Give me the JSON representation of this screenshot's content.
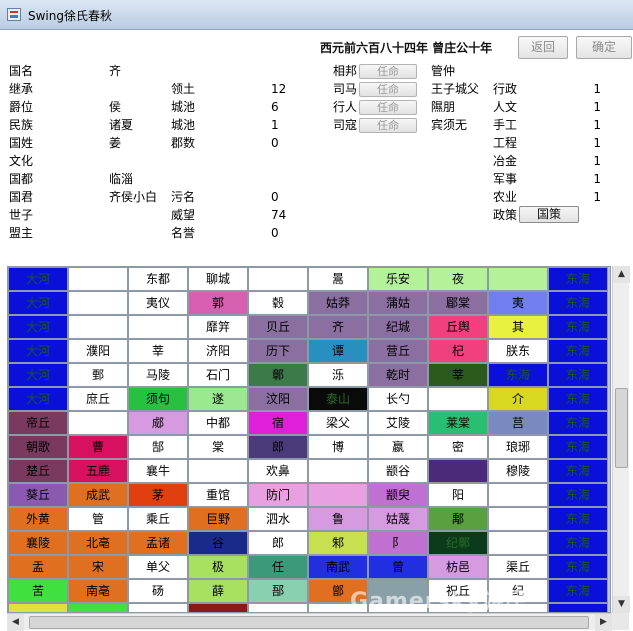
{
  "window": {
    "title": "Swing徐氏春秋"
  },
  "header": {
    "date_text": "西元前六百八十四年 曾庄公十年",
    "back_label": "返回",
    "confirm_label": "确定"
  },
  "country": {
    "name_label": "国名",
    "name_value": "齐",
    "heir_label": "继承",
    "rank_label": "爵位",
    "rank_value": "侯",
    "ethnicity_label": "民族",
    "ethnicity_value": "诸夏",
    "surname_label": "国姓",
    "surname_value": "姜",
    "culture_label": "文化",
    "capital_label": "国都",
    "capital_value": "临淄",
    "ruler_label": "国君",
    "ruler_value": "齐侯小白",
    "heir_son_label": "世子",
    "alliance_label": "盟主"
  },
  "stats": {
    "territory_label": "领土",
    "territory_value": "12",
    "cities_label": "城池",
    "cities_value": "6",
    "cities2_label": "城池",
    "cities2_value": "1",
    "prefectures_label": "郡数",
    "prefectures_value": "0",
    "infamy_label": "污名",
    "infamy_value": "0",
    "prestige_label": "威望",
    "prestige_value": "74",
    "honor_label": "名誉",
    "honor_value": "0"
  },
  "officials": {
    "chancellor_label": "相邦",
    "chancellor_person": "管仲",
    "sima_label": "司马",
    "sima_person": "王子城父",
    "envoy_label": "行人",
    "envoy_person": "隰朋",
    "sikou_label": "司寇",
    "sikou_person": "宾须无",
    "appoint_label": "任命"
  },
  "ministries": [
    {
      "label": "行政",
      "value": "1"
    },
    {
      "label": "人文",
      "value": "1"
    },
    {
      "label": "手工",
      "value": "1"
    },
    {
      "label": "工程",
      "value": "1"
    },
    {
      "label": "冶金",
      "value": "1"
    },
    {
      "label": "军事",
      "value": "1"
    },
    {
      "label": "农业",
      "value": "1"
    }
  ],
  "policy": {
    "label": "政策",
    "button_label": "国策"
  },
  "map_rows": [
    [
      {
        "t": "大河",
        "bg": "#0a10d8",
        "fg": "#1a5a1a"
      },
      {
        "t": "",
        "bg": "#ffffff",
        "fg": "#000"
      },
      {
        "t": "东都",
        "bg": "#ffffff",
        "fg": "#000"
      },
      {
        "t": "聊城",
        "bg": "#ffffff",
        "fg": "#000"
      },
      {
        "t": "",
        "bg": "#ffffff",
        "fg": "#000"
      },
      {
        "t": "暠",
        "bg": "#ffffff",
        "fg": "#000"
      },
      {
        "t": "乐安",
        "bg": "#b4f29a",
        "fg": "#000"
      },
      {
        "t": "夜",
        "bg": "#b4f29a",
        "fg": "#000"
      },
      {
        "t": "",
        "bg": "#b4f29a",
        "fg": "#000"
      },
      {
        "t": "东海",
        "bg": "#0a10d8",
        "fg": "#1a5a1a"
      }
    ],
    [
      {
        "t": "大河",
        "bg": "#0a10d8",
        "fg": "#1a5a1a"
      },
      {
        "t": "",
        "bg": "#ffffff",
        "fg": "#000"
      },
      {
        "t": "夷仪",
        "bg": "#ffffff",
        "fg": "#000"
      },
      {
        "t": "郭",
        "bg": "#d65fb0",
        "fg": "#000"
      },
      {
        "t": "毂",
        "bg": "#ffffff",
        "fg": "#000"
      },
      {
        "t": "姑莽",
        "bg": "#8a6fa0",
        "fg": "#000"
      },
      {
        "t": "蒲姑",
        "bg": "#8a6fa0",
        "fg": "#000"
      },
      {
        "t": "郿棠",
        "bg": "#8a6fa0",
        "fg": "#000"
      },
      {
        "t": "夷",
        "bg": "#6f7ff0",
        "fg": "#000"
      },
      {
        "t": "东海",
        "bg": "#0a10d8",
        "fg": "#1a5a1a"
      }
    ],
    [
      {
        "t": "大河",
        "bg": "#0a10d8",
        "fg": "#1a5a1a"
      },
      {
        "t": "",
        "bg": "#ffffff",
        "fg": "#000"
      },
      {
        "t": "",
        "bg": "#ffffff",
        "fg": "#000"
      },
      {
        "t": "靡笄",
        "bg": "#ffffff",
        "fg": "#000"
      },
      {
        "t": "贝丘",
        "bg": "#8a6fa0",
        "fg": "#000"
      },
      {
        "t": "齐",
        "bg": "#8a6fa0",
        "fg": "#000"
      },
      {
        "t": "纪城",
        "bg": "#8a6fa0",
        "fg": "#000"
      },
      {
        "t": "丘舆",
        "bg": "#f04080",
        "fg": "#000"
      },
      {
        "t": "其",
        "bg": "#e8f040",
        "fg": "#000"
      },
      {
        "t": "东海",
        "bg": "#0a10d8",
        "fg": "#1a5a1a"
      }
    ],
    [
      {
        "t": "大河",
        "bg": "#0a10d8",
        "fg": "#1a5a1a"
      },
      {
        "t": "濮阳",
        "bg": "#ffffff",
        "fg": "#000"
      },
      {
        "t": "莘",
        "bg": "#ffffff",
        "fg": "#000"
      },
      {
        "t": "济阳",
        "bg": "#ffffff",
        "fg": "#000"
      },
      {
        "t": "历下",
        "bg": "#8a6fa0",
        "fg": "#000"
      },
      {
        "t": "谭",
        "bg": "#2890c0",
        "fg": "#000"
      },
      {
        "t": "营丘",
        "bg": "#8a6fa0",
        "fg": "#000"
      },
      {
        "t": "杞",
        "bg": "#f04080",
        "fg": "#000"
      },
      {
        "t": "朕东",
        "bg": "#ffffff",
        "fg": "#000"
      },
      {
        "t": "东海",
        "bg": "#0a10d8",
        "fg": "#1a5a1a"
      }
    ],
    [
      {
        "t": "大河",
        "bg": "#0a10d8",
        "fg": "#1a5a1a"
      },
      {
        "t": "鄄",
        "bg": "#ffffff",
        "fg": "#000"
      },
      {
        "t": "马陵",
        "bg": "#ffffff",
        "fg": "#000"
      },
      {
        "t": "石门",
        "bg": "#ffffff",
        "fg": "#000"
      },
      {
        "t": "鄣",
        "bg": "#3c7a4a",
        "fg": "#000"
      },
      {
        "t": "泺",
        "bg": "#ffffff",
        "fg": "#000"
      },
      {
        "t": "乾时",
        "bg": "#8a6fa0",
        "fg": "#000"
      },
      {
        "t": "莘",
        "bg": "#2c5a1c",
        "fg": "#000"
      },
      {
        "t": "东海",
        "bg": "#0a10d8",
        "fg": "#1a5a1a"
      },
      {
        "t": "东海",
        "bg": "#0a10d8",
        "fg": "#1a5a1a"
      }
    ],
    [
      {
        "t": "大河",
        "bg": "#0a10d8",
        "fg": "#1a5a1a"
      },
      {
        "t": "庶丘",
        "bg": "#ffffff",
        "fg": "#000"
      },
      {
        "t": "须句",
        "bg": "#28c040",
        "fg": "#000"
      },
      {
        "t": "遂",
        "bg": "#9ce890",
        "fg": "#000"
      },
      {
        "t": "汶阳",
        "bg": "#8a6fa0",
        "fg": "#000"
      },
      {
        "t": "泰山",
        "bg": "#0a0a0a",
        "fg": "#2a6a2a"
      },
      {
        "t": "长勺",
        "bg": "#ffffff",
        "fg": "#000"
      },
      {
        "t": "",
        "bg": "#ffffff",
        "fg": "#000"
      },
      {
        "t": "介",
        "bg": "#d8d820",
        "fg": "#000"
      },
      {
        "t": "东海",
        "bg": "#0a10d8",
        "fg": "#1a5a1a"
      }
    ],
    [
      {
        "t": "帝丘",
        "bg": "#7a3a60",
        "fg": "#000"
      },
      {
        "t": "",
        "bg": "#ffffff",
        "fg": "#000"
      },
      {
        "t": "郕",
        "bg": "#d69ae0",
        "fg": "#000"
      },
      {
        "t": "中都",
        "bg": "#ffffff",
        "fg": "#000"
      },
      {
        "t": "宿",
        "bg": "#e020d8",
        "fg": "#000"
      },
      {
        "t": "梁父",
        "bg": "#ffffff",
        "fg": "#000"
      },
      {
        "t": "艾陵",
        "bg": "#ffffff",
        "fg": "#000"
      },
      {
        "t": "莱棠",
        "bg": "#28c070",
        "fg": "#000"
      },
      {
        "t": "莒",
        "bg": "#7a8ac0",
        "fg": "#000"
      },
      {
        "t": "东海",
        "bg": "#0a10d8",
        "fg": "#1a5a1a"
      }
    ],
    [
      {
        "t": "朝歌",
        "bg": "#7a3a60",
        "fg": "#000"
      },
      {
        "t": "曹",
        "bg": "#d81060",
        "fg": "#000"
      },
      {
        "t": "郜",
        "bg": "#ffffff",
        "fg": "#000"
      },
      {
        "t": "棠",
        "bg": "#ffffff",
        "fg": "#000"
      },
      {
        "t": "郎",
        "bg": "#4a3a7a",
        "fg": "#000"
      },
      {
        "t": "博",
        "bg": "#ffffff",
        "fg": "#000"
      },
      {
        "t": "嬴",
        "bg": "#ffffff",
        "fg": "#000"
      },
      {
        "t": "密",
        "bg": "#ffffff",
        "fg": "#000"
      },
      {
        "t": "琅琊",
        "bg": "#ffffff",
        "fg": "#000"
      },
      {
        "t": "东海",
        "bg": "#0a10d8",
        "fg": "#1a5a1a"
      }
    ],
    [
      {
        "t": "楚丘",
        "bg": "#7a3a60",
        "fg": "#000"
      },
      {
        "t": "五鹿",
        "bg": "#d81060",
        "fg": "#000"
      },
      {
        "t": "襄牛",
        "bg": "#ffffff",
        "fg": "#000"
      },
      {
        "t": "",
        "bg": "#ffffff",
        "fg": "#000"
      },
      {
        "t": "欢鼻",
        "bg": "#ffffff",
        "fg": "#000"
      },
      {
        "t": "",
        "bg": "#ffffff",
        "fg": "#000"
      },
      {
        "t": "颛谷",
        "bg": "#ffffff",
        "fg": "#000"
      },
      {
        "t": "",
        "bg": "#4a2a7a",
        "fg": "#000"
      },
      {
        "t": "穆陵",
        "bg": "#ffffff",
        "fg": "#000"
      },
      {
        "t": "东海",
        "bg": "#0a10d8",
        "fg": "#1a5a1a"
      }
    ],
    [
      {
        "t": "葵丘",
        "bg": "#8a5ab0",
        "fg": "#000"
      },
      {
        "t": "成武",
        "bg": "#e07020",
        "fg": "#000"
      },
      {
        "t": "茅",
        "bg": "#e04010",
        "fg": "#000"
      },
      {
        "t": "重馆",
        "bg": "#ffffff",
        "fg": "#000"
      },
      {
        "t": "防门",
        "bg": "#e8a0e0",
        "fg": "#000"
      },
      {
        "t": "",
        "bg": "#e8a0e0",
        "fg": "#000"
      },
      {
        "t": "颛臾",
        "bg": "#c070d0",
        "fg": "#000"
      },
      {
        "t": "阳",
        "bg": "#ffffff",
        "fg": "#000"
      },
      {
        "t": "",
        "bg": "#ffffff",
        "fg": "#000"
      },
      {
        "t": "东海",
        "bg": "#0a10d8",
        "fg": "#1a5a1a"
      }
    ],
    [
      {
        "t": "外黄",
        "bg": "#e07020",
        "fg": "#000"
      },
      {
        "t": "管",
        "bg": "#ffffff",
        "fg": "#000"
      },
      {
        "t": "乘丘",
        "bg": "#ffffff",
        "fg": "#000"
      },
      {
        "t": "巨野",
        "bg": "#e07020",
        "fg": "#000"
      },
      {
        "t": "泗水",
        "bg": "#ffffff",
        "fg": "#000"
      },
      {
        "t": "鲁",
        "bg": "#d69ae0",
        "fg": "#000"
      },
      {
        "t": "姑蔑",
        "bg": "#d69ae0",
        "fg": "#000"
      },
      {
        "t": "鄅",
        "bg": "#58a040",
        "fg": "#000"
      },
      {
        "t": "",
        "bg": "#ffffff",
        "fg": "#000"
      },
      {
        "t": "东海",
        "bg": "#0a10d8",
        "fg": "#1a5a1a"
      }
    ],
    [
      {
        "t": "襄陵",
        "bg": "#e07020",
        "fg": "#000"
      },
      {
        "t": "北亳",
        "bg": "#e07020",
        "fg": "#000"
      },
      {
        "t": "孟诸",
        "bg": "#e07020",
        "fg": "#000"
      },
      {
        "t": "谷",
        "bg": "#1a2a8a",
        "fg": "#000"
      },
      {
        "t": "郎",
        "bg": "#ffffff",
        "fg": "#000"
      },
      {
        "t": "邾",
        "bg": "#c8e050",
        "fg": "#000"
      },
      {
        "t": "阝",
        "bg": "#c070d0",
        "fg": "#000"
      },
      {
        "t": "纪鄣",
        "bg": "#0a3a1a",
        "fg": "#2a6a2a"
      },
      {
        "t": "",
        "bg": "#ffffff",
        "fg": "#000"
      },
      {
        "t": "东海",
        "bg": "#0a10d8",
        "fg": "#1a5a1a"
      }
    ],
    [
      {
        "t": "盂",
        "bg": "#e07020",
        "fg": "#000"
      },
      {
        "t": "宋",
        "bg": "#e07020",
        "fg": "#000"
      },
      {
        "t": "单父",
        "bg": "#ffffff",
        "fg": "#000"
      },
      {
        "t": "极",
        "bg": "#a8e060",
        "fg": "#000"
      },
      {
        "t": "任",
        "bg": "#3c9a7a",
        "fg": "#000"
      },
      {
        "t": "南武",
        "bg": "#2030e0",
        "fg": "#000"
      },
      {
        "t": "曾",
        "bg": "#2030e0",
        "fg": "#000"
      },
      {
        "t": "枋邑",
        "bg": "#d69ae0",
        "fg": "#000"
      },
      {
        "t": "渠丘",
        "bg": "#ffffff",
        "fg": "#000"
      },
      {
        "t": "东海",
        "bg": "#0a10d8",
        "fg": "#1a5a1a"
      }
    ],
    [
      {
        "t": "苦",
        "bg": "#40e040",
        "fg": "#000"
      },
      {
        "t": "南亳",
        "bg": "#e07020",
        "fg": "#000"
      },
      {
        "t": "砀",
        "bg": "#ffffff",
        "fg": "#000"
      },
      {
        "t": "薛",
        "bg": "#a8e060",
        "fg": "#000"
      },
      {
        "t": "郚",
        "bg": "#88d0b0",
        "fg": "#000"
      },
      {
        "t": "鄫",
        "bg": "#e07020",
        "fg": "#000"
      },
      {
        "t": "",
        "bg": "#8aa0a8",
        "fg": "#000"
      },
      {
        "t": "祝丘",
        "bg": "#ffffff",
        "fg": "#000"
      },
      {
        "t": "纪",
        "bg": "#ffffff",
        "fg": "#000"
      },
      {
        "t": "东海",
        "bg": "#0a10d8",
        "fg": "#1a5a1a"
      }
    ],
    [
      {
        "t": "",
        "bg": "#e0e040",
        "fg": "#000"
      },
      {
        "t": "",
        "bg": "#40e040",
        "fg": "#000"
      },
      {
        "t": "",
        "bg": "#ffffff",
        "fg": "#000"
      },
      {
        "t": "",
        "bg": "#8a1a1a",
        "fg": "#000"
      },
      {
        "t": "",
        "bg": "#ffffff",
        "fg": "#000"
      },
      {
        "t": "",
        "bg": "#ffffff",
        "fg": "#000"
      },
      {
        "t": "",
        "bg": "#ffffff",
        "fg": "#000"
      },
      {
        "t": "",
        "bg": "#ffffff",
        "fg": "#000"
      },
      {
        "t": "",
        "bg": "#ffffff",
        "fg": "#000"
      },
      {
        "t": "",
        "bg": "#0a10d8",
        "fg": "#000"
      }
    ]
  ],
  "icons": {
    "window_icon": "app-icon",
    "scroll_up": "arrow-up-icon",
    "scroll_down": "arrow-down-icon",
    "scroll_left": "arrow-left-icon",
    "scroll_right": "arrow-right-icon"
  },
  "watermark": "Gamersky游民"
}
